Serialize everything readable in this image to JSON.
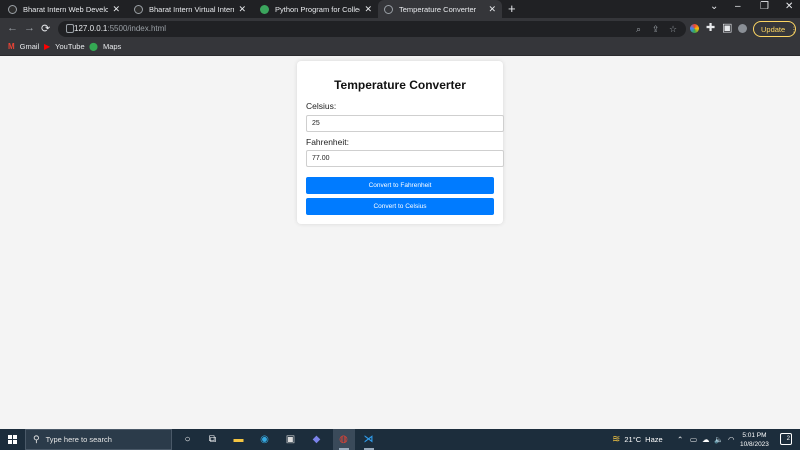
{
  "browser": {
    "tabs": [
      {
        "title": "Bharat Intern Web Development",
        "active": false
      },
      {
        "title": "Bharat Intern Virtual Internship",
        "active": false
      },
      {
        "title": "Python Program for Collecting",
        "active": false
      },
      {
        "title": "Temperature Converter",
        "active": true
      }
    ],
    "url_host": "127.0.0.1",
    "url_rest": ":5500/index.html",
    "update_label": "Update",
    "bookmarks": [
      {
        "label": "Gmail"
      },
      {
        "label": "YouTube"
      },
      {
        "label": "Maps"
      }
    ]
  },
  "page": {
    "title": "Temperature Converter",
    "celsius_label": "Celsius:",
    "celsius_value": "25",
    "fahrenheit_label": "Fahrenheit:",
    "fahrenheit_value": "77.00",
    "to_fahrenheit_label": "Convert to Fahrenheit",
    "to_celsius_label": "Convert to Celsius",
    "button_color": "#007bff"
  },
  "taskbar": {
    "search_placeholder": "Type here to search",
    "weather_temp": "21°C",
    "weather_desc": "Haze",
    "time": "5:01 PM",
    "date": "10/8/2023",
    "notification_count": "2"
  }
}
